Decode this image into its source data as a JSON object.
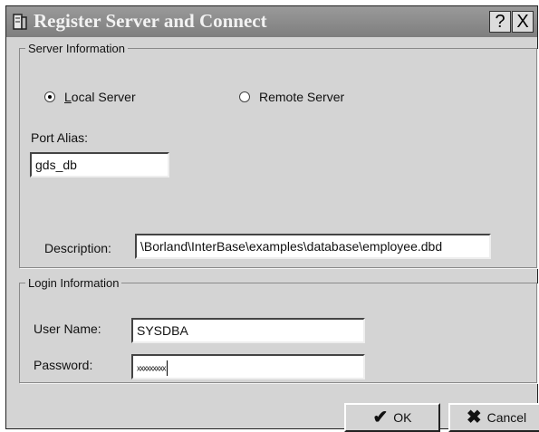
{
  "window": {
    "title": "Register Server and Connect",
    "help_label": "?",
    "close_label": "X"
  },
  "server_info": {
    "legend": "Server Information",
    "local_server_label": "Local Server",
    "remote_server_label": "Remote Server",
    "selected": "Local Server",
    "port_alias_label": "Port Alias:",
    "port_alias_value": "gds_db",
    "description_label": "Description:",
    "description_value": "\\Borland\\InterBase\\examples\\database\\employee.dbd"
  },
  "login_info": {
    "legend": "Login Information",
    "user_name_label": "User Name:",
    "user_name_value": "SYSDBA",
    "password_label": "Password:",
    "password_mask": "xxxxxxxxx"
  },
  "buttons": {
    "ok_label": "OK",
    "cancel_label": "Cancel"
  },
  "icons": {
    "window": "database-server-icon",
    "ok": "checkmark-icon",
    "cancel": "x-mark-icon"
  }
}
